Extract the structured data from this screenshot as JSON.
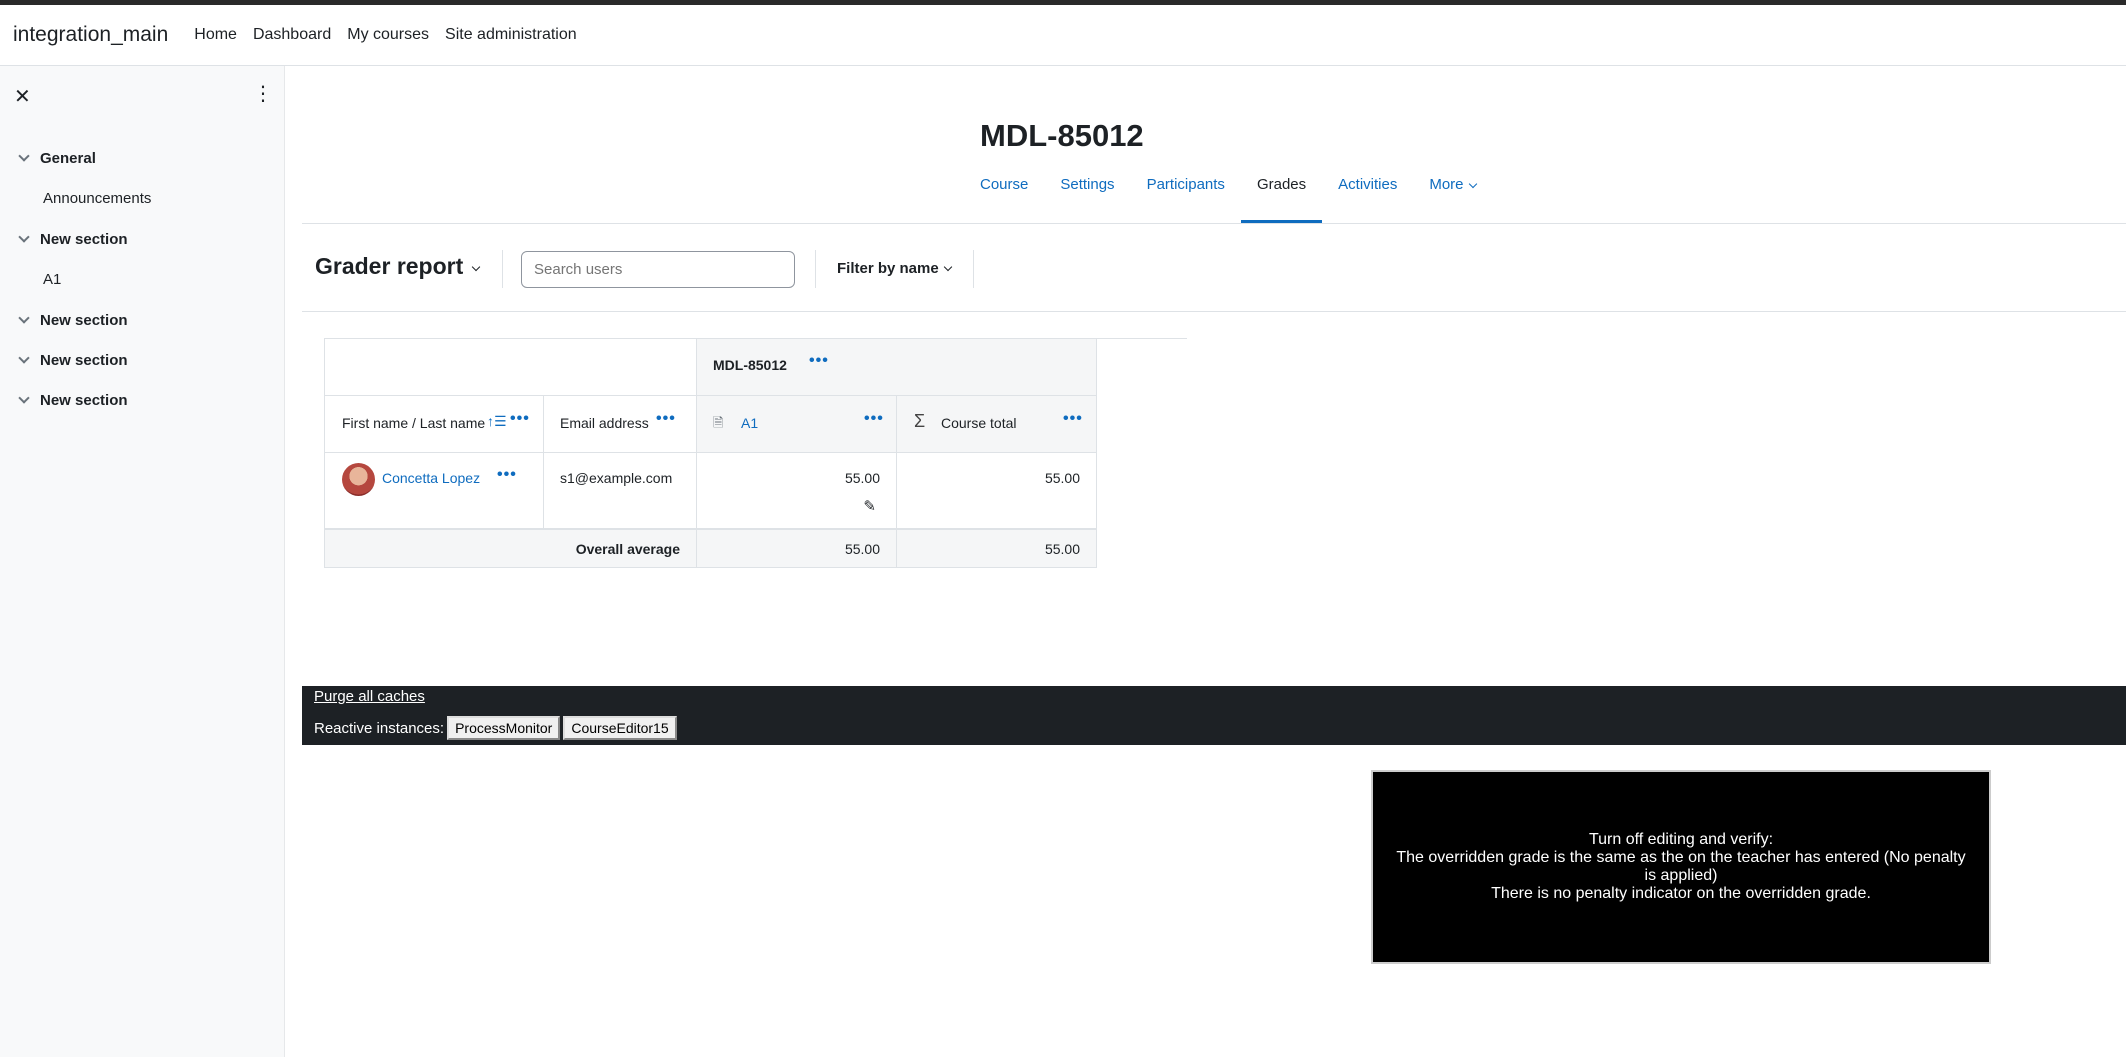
{
  "navbar": {
    "brand": "integration_main",
    "items": [
      "Home",
      "Dashboard",
      "My courses",
      "Site administration"
    ]
  },
  "drawer": {
    "close_icon": "close-icon",
    "menu_icon": "kebab-icon",
    "sections": [
      {
        "title": "General",
        "activities": [
          "Announcements"
        ]
      },
      {
        "title": "New section",
        "activities": [
          "A1"
        ]
      },
      {
        "title": "New section",
        "activities": []
      },
      {
        "title": "New section",
        "activities": []
      },
      {
        "title": "New section",
        "activities": []
      }
    ]
  },
  "course": {
    "title": "MDL-85012",
    "tabs": [
      "Course",
      "Settings",
      "Participants",
      "Grades",
      "Activities",
      "More"
    ],
    "active_tab": "Grades"
  },
  "tertiary": {
    "report_label": "Grader report",
    "search_placeholder": "Search users",
    "filter_label": "Filter by name"
  },
  "grader": {
    "category_header": "MDL-85012",
    "col_name": "First name / Last name",
    "col_email": "Email address",
    "col_a1": "A1",
    "col_total": "Course total",
    "rows": [
      {
        "name": "Concetta Lopez",
        "email": "s1@example.com",
        "a1": "55.00",
        "total": "55.00"
      }
    ],
    "avg_label": "Overall average",
    "avg_a1": "55.00",
    "avg_total": "55.00"
  },
  "footer": {
    "purge": "Purge all caches",
    "reactive_label": "Reactive instances:",
    "reactive_buttons": [
      "ProcessMonitor",
      "CourseEditor15"
    ]
  },
  "overlay": {
    "line1": "Turn off editing and verify:",
    "line2": "The overridden grade is the same as the on the teacher has entered (No penalty is applied)",
    "line3": "There is no penalty indicator on the overridden grade."
  },
  "colors": {
    "link": "#0f6cbf",
    "text": "#1d2125",
    "footer_bg": "#1d2125",
    "drawer_bg": "#f8f9fa"
  }
}
